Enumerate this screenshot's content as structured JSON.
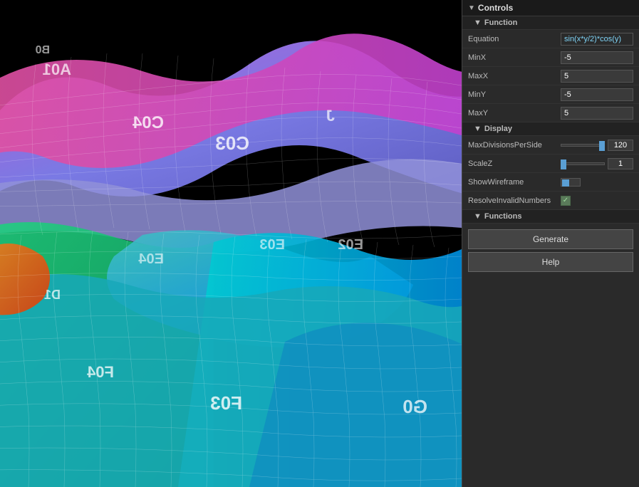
{
  "panel": {
    "title": "Controls",
    "sections": {
      "function": {
        "label": "Function",
        "fields": {
          "equation": {
            "label": "Equation",
            "value": "sin(x*y/2)*cos(y)"
          },
          "minX": {
            "label": "MinX",
            "value": "-5"
          },
          "maxX": {
            "label": "MaxX",
            "value": "5"
          },
          "minY": {
            "label": "MinY",
            "value": "-5"
          },
          "maxY": {
            "label": "MaxY",
            "value": "5"
          }
        }
      },
      "display": {
        "label": "Display",
        "fields": {
          "maxDivisionsPerSide": {
            "label": "MaxDivisionsPerSide",
            "value": "120",
            "sliderPercent": 95
          },
          "scaleZ": {
            "label": "ScaleZ",
            "value": "1",
            "sliderPercent": 5
          },
          "showWireframe": {
            "label": "ShowWireframe",
            "checked": false
          },
          "resolveInvalidNumbers": {
            "label": "ResolveInvalidNumbers",
            "checked": true
          }
        }
      },
      "functions": {
        "label": "Functions",
        "buttons": {
          "generate": "Generate",
          "help": "Help"
        }
      }
    }
  },
  "icons": {
    "arrow_down": "▼",
    "checkmark": "✓"
  }
}
